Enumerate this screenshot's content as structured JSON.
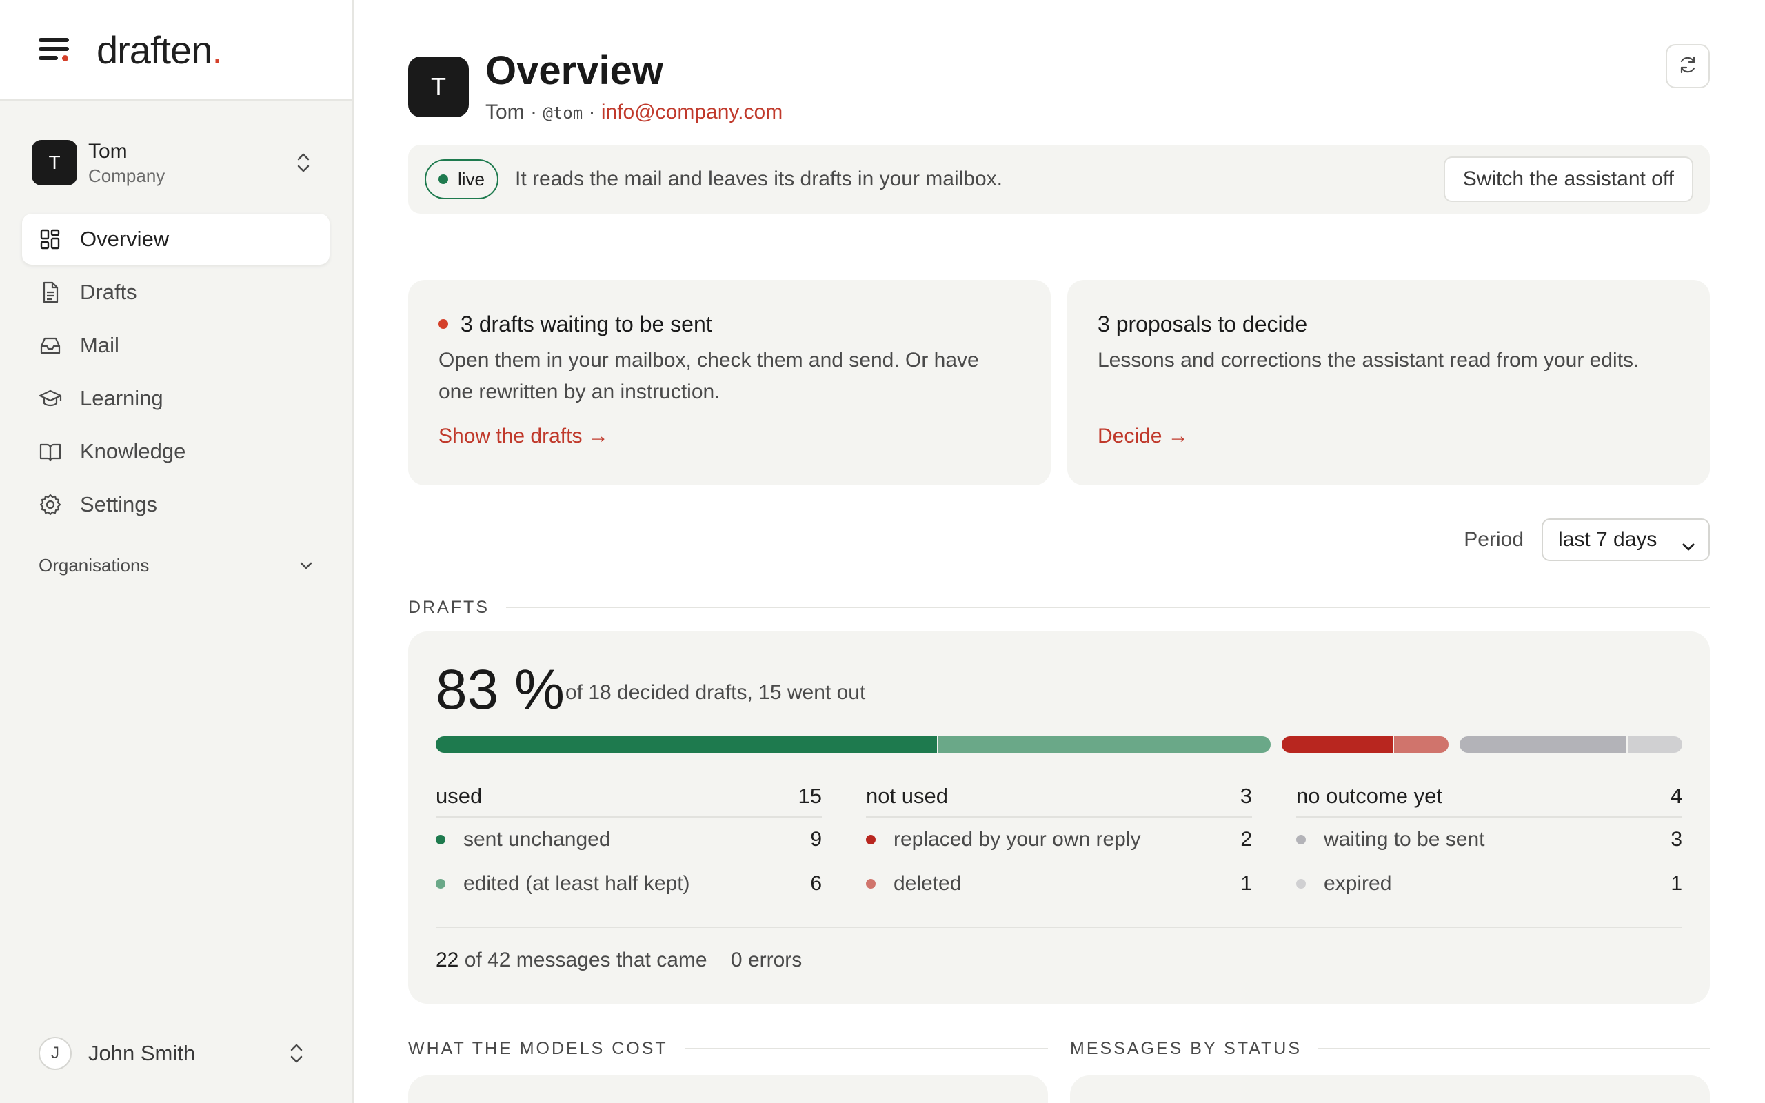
{
  "brand": {
    "logo_text": "draften",
    "logo_dot": ".",
    "accent_color": "#d4402a"
  },
  "sidebar": {
    "account": {
      "initial": "T",
      "name": "Tom",
      "subtitle": "Company"
    },
    "items": [
      {
        "label": "Overview",
        "icon": "grid-icon",
        "active": true
      },
      {
        "label": "Drafts",
        "icon": "document-icon",
        "active": false
      },
      {
        "label": "Mail",
        "icon": "inbox-icon",
        "active": false
      },
      {
        "label": "Learning",
        "icon": "graduation-cap-icon",
        "active": false
      },
      {
        "label": "Knowledge",
        "icon": "book-icon",
        "active": false
      },
      {
        "label": "Settings",
        "icon": "gear-icon",
        "active": false
      }
    ],
    "organisations_label": "Organisations",
    "user": {
      "initial": "J",
      "name": "John Smith"
    }
  },
  "header": {
    "avatar_initial": "T",
    "title": "Overview",
    "name": "Tom",
    "separator": "·",
    "handle": "@tom",
    "email": "info@company.com"
  },
  "status": {
    "badge": "live",
    "text": "It reads the mail and leaves its drafts in your mailbox.",
    "button": "Switch the assistant off"
  },
  "cards": [
    {
      "title": "3 drafts waiting to be sent",
      "description": "Open them in your mailbox, check them and send. Or have one rewritten by an instruction.",
      "link": "Show the drafts →"
    },
    {
      "title": "3 proposals to decide",
      "description": "Lessons and corrections the assistant read from your edits.",
      "link": "Decide →"
    }
  ],
  "period": {
    "label": "Period",
    "selected": "last 7 days"
  },
  "drafts": {
    "section_label": "DRAFTS",
    "percent": "83 %",
    "summary": "of 18 decided drafts, 15 went out",
    "groups": [
      {
        "title": "used",
        "total": "15",
        "rows": [
          {
            "label": "sent unchanged",
            "value": "9",
            "color": "#1e7a4e",
            "count": 9
          },
          {
            "label": "edited (at least half kept)",
            "value": "6",
            "color": "#6aa888",
            "count": 6
          }
        ]
      },
      {
        "title": "not used",
        "total": "3",
        "rows": [
          {
            "label": "replaced by your own reply",
            "value": "2",
            "color": "#b8261f",
            "count": 2
          },
          {
            "label": "deleted",
            "value": "1",
            "color": "#d0746c",
            "count": 1
          }
        ]
      },
      {
        "title": "no outcome yet",
        "total": "4",
        "rows": [
          {
            "label": "waiting to be sent",
            "value": "3",
            "color": "#b3b3b8",
            "count": 3
          },
          {
            "label": "expired",
            "value": "1",
            "color": "#d0d0d2",
            "count": 1
          }
        ]
      }
    ],
    "footer": {
      "count": "22",
      "messages_text": "of 42 messages that came",
      "errors_text": "0 errors"
    }
  },
  "sections": {
    "cost": "WHAT THE MODELS COST",
    "status": "MESSAGES BY STATUS"
  }
}
